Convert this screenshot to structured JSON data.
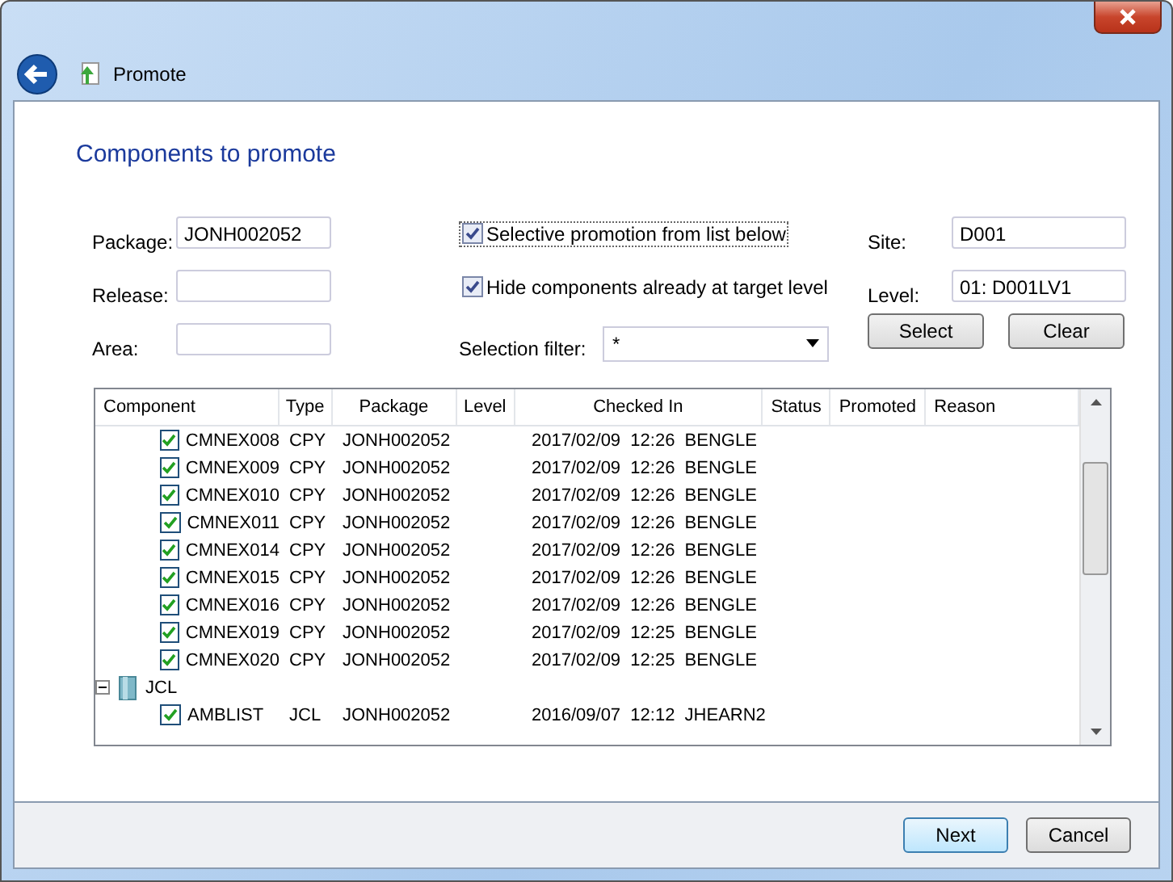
{
  "window": {
    "title": "Promote"
  },
  "heading": "Components to promote",
  "form": {
    "package": {
      "label": "Package:",
      "value": "JONH002052"
    },
    "release": {
      "label": "Release:"
    },
    "area": {
      "label": "Area:"
    },
    "options": [
      {
        "label": "Selective promotion from list below",
        "checked": true,
        "focused": true
      },
      {
        "label": "Hide components already at target level",
        "checked": true,
        "focused": false
      }
    ],
    "filter": {
      "label": "Selection filter:",
      "value": "*"
    },
    "site": {
      "label": "Site:",
      "value": "D001"
    },
    "level": {
      "label": "Level:",
      "value": "01: D001LV1"
    },
    "buttons": [
      "Select",
      "Clear"
    ]
  },
  "table": {
    "columns": [
      "Component",
      "Type",
      "Package",
      "Level",
      "Checked In",
      "Status",
      "Promoted",
      "Reason"
    ],
    "rows": [
      {
        "kind": "component",
        "checked": true,
        "name": "CMNEX008",
        "type": "CPY",
        "package": "JONH002052",
        "checked_in": "2017/02/09  12:26  BENGLE"
      },
      {
        "kind": "component",
        "checked": true,
        "name": "CMNEX009",
        "type": "CPY",
        "package": "JONH002052",
        "checked_in": "2017/02/09  12:26  BENGLE"
      },
      {
        "kind": "component",
        "checked": true,
        "name": "CMNEX010",
        "type": "CPY",
        "package": "JONH002052",
        "checked_in": "2017/02/09  12:26  BENGLE"
      },
      {
        "kind": "component",
        "checked": true,
        "name": "CMNEX011",
        "type": "CPY",
        "package": "JONH002052",
        "checked_in": "2017/02/09  12:26  BENGLE"
      },
      {
        "kind": "component",
        "checked": true,
        "name": "CMNEX014",
        "type": "CPY",
        "package": "JONH002052",
        "checked_in": "2017/02/09  12:26  BENGLE"
      },
      {
        "kind": "component",
        "checked": true,
        "name": "CMNEX015",
        "type": "CPY",
        "package": "JONH002052",
        "checked_in": "2017/02/09  12:26  BENGLE"
      },
      {
        "kind": "component",
        "checked": true,
        "name": "CMNEX016",
        "type": "CPY",
        "package": "JONH002052",
        "checked_in": "2017/02/09  12:26  BENGLE"
      },
      {
        "kind": "component",
        "checked": true,
        "name": "CMNEX019",
        "type": "CPY",
        "package": "JONH002052",
        "checked_in": "2017/02/09  12:25  BENGLE"
      },
      {
        "kind": "component",
        "checked": true,
        "name": "CMNEX020",
        "type": "CPY",
        "package": "JONH002052",
        "checked_in": "2017/02/09  12:25  BENGLE"
      },
      {
        "kind": "group",
        "name": "JCL",
        "expanded": true,
        "children": [
          {
            "kind": "component",
            "checked": true,
            "name": "AMBLIST",
            "type": "JCL",
            "package": "JONH002052",
            "checked_in": "2016/09/07  12:12  JHEARN2"
          }
        ]
      }
    ]
  },
  "footer": {
    "buttons": [
      {
        "label": "Next",
        "default": true
      },
      {
        "label": "Cancel",
        "default": false
      }
    ]
  }
}
